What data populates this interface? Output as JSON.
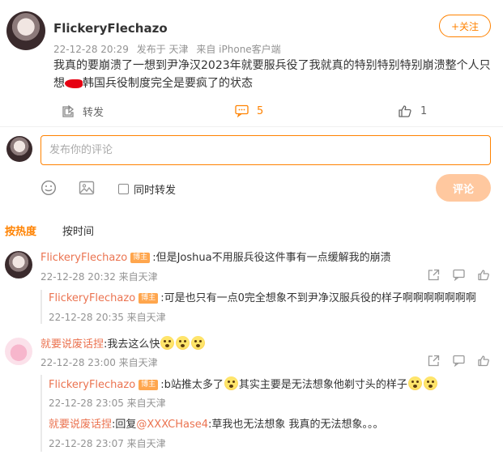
{
  "post": {
    "username": "FlickeryFlechazo",
    "timestamp": "22-12-28 20:29",
    "source": "发布于 天津",
    "device": "来自 iPhone客户端",
    "follow_label": "+关注",
    "text_before_censor": "我真的要崩溃了一想到尹净汉2023年就要服兵役了我就真的特别特别特别崩溃整个人只想",
    "text_after_censor": "韩国兵役制度完全是要疯了的状态",
    "forward_label": "转发",
    "comment_count": "5",
    "like_count": "1"
  },
  "composer": {
    "placeholder": "发布你的评论",
    "repost_label": "同时转发",
    "submit_label": "评论"
  },
  "sort_tabs": {
    "hot": "按热度",
    "time": "按时间"
  },
  "comments": [
    {
      "name": "FlickeryFlechazo",
      "badge": "博主",
      "text": ":但是Joshua不用服兵役这件事有一点缓解我的崩溃",
      "meta": "22-12-28 20:32 来自天津",
      "replies": [
        {
          "name": "FlickeryFlechazo",
          "badge": "博主",
          "text": ":可是也只有一点0完全想象不到尹净汉服兵役的样子啊啊啊啊啊啊啊",
          "meta": "22-12-28 20:35 来自天津"
        }
      ]
    },
    {
      "name": "就要说废话捏",
      "text": ":我去这么快",
      "meta": "22-12-28 23:00 来自天津",
      "replies": [
        {
          "name": "FlickeryFlechazo",
          "badge": "博主",
          "text_before": ":b站推太多了",
          "text_middle": "其实主要是无法想象他剃寸头的样子",
          "meta": "22-12-28 23:05 来自天津"
        },
        {
          "name": "就要说废话捏",
          "text": ":回复",
          "mention": "@XXXCHase4",
          "text_after": ":草我也无法想象 我真的无法想象。。。",
          "meta": "22-12-28 23:07 来自天津"
        }
      ]
    }
  ],
  "colors": {
    "accent": "#ff8200",
    "name": "#eb7350",
    "meta": "#939393"
  }
}
